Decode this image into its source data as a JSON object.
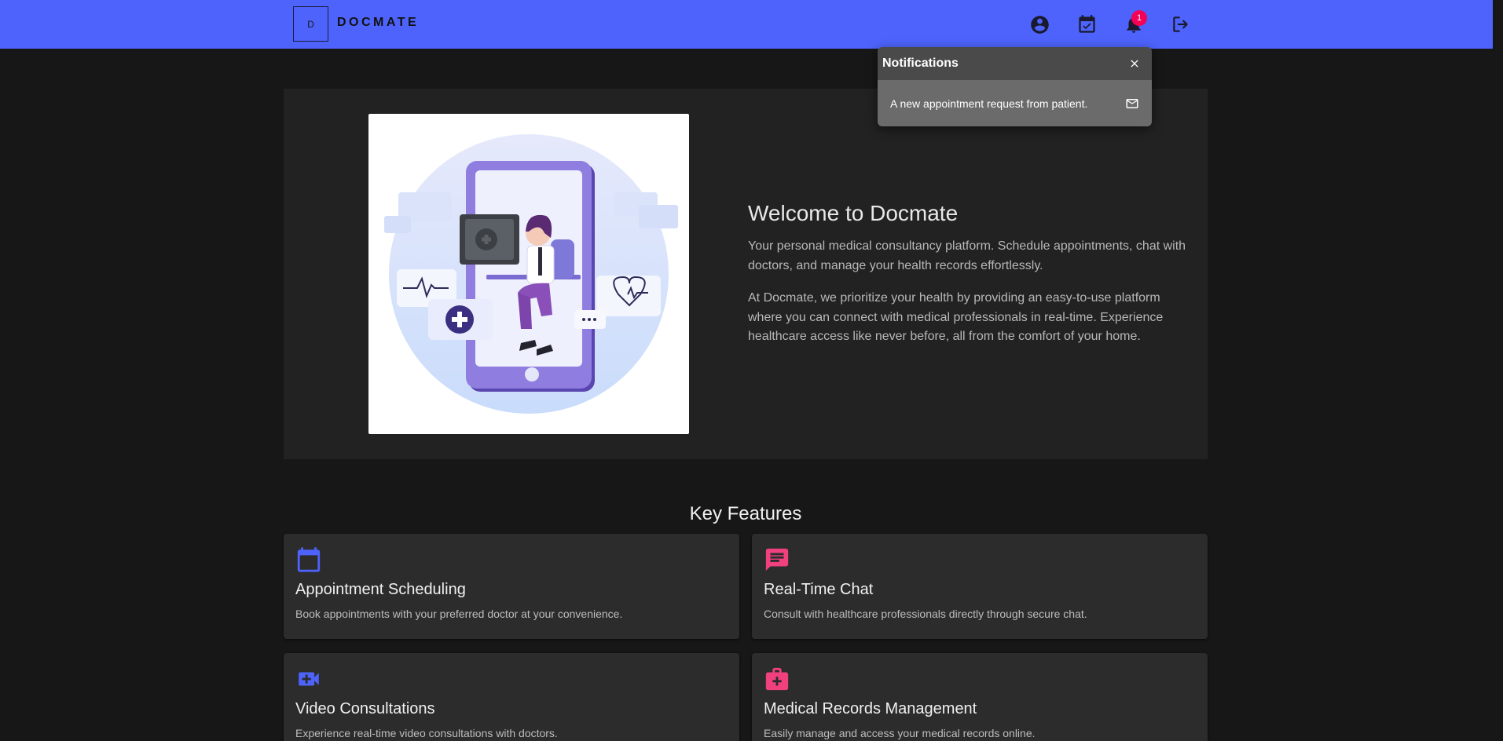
{
  "header": {
    "logo_text": "D",
    "brand": "DOCMATE",
    "notification_count": "1",
    "icons": [
      "account-circle-icon",
      "calendar-check-icon",
      "bell-icon",
      "logout-icon"
    ],
    "accent_color": "#4d63fb"
  },
  "notifications": {
    "title": "Notifications",
    "items": [
      {
        "text": "A new appointment request from patient.",
        "icon": "mail-icon"
      }
    ]
  },
  "hero": {
    "title": "Welcome to Docmate",
    "paragraph1": "Your personal medical consultancy platform. Schedule appointments, chat with doctors, and manage your health records effortlessly.",
    "paragraph2": "At Docmate, we prioritize your health by providing an easy-to-use platform where you can connect with medical professionals in real-time. Experience healthcare access like never before, all from the comfort of your home."
  },
  "features": {
    "title": "Key Features",
    "cards": [
      {
        "title": "Appointment Scheduling",
        "desc": "Book appointments with your preferred doctor at your convenience.",
        "icon": "calendar-icon",
        "color": "#4d63fb"
      },
      {
        "title": "Real-Time Chat",
        "desc": "Consult with healthcare professionals directly through secure chat.",
        "icon": "chat-icon",
        "color": "#f0417e"
      },
      {
        "title": "Video Consultations",
        "desc": "Experience real-time video consultations with doctors.",
        "icon": "video-call-icon",
        "color": "#4d63fb"
      },
      {
        "title": "Medical Records Management",
        "desc": "Easily manage and access your medical records online.",
        "icon": "medical-bag-icon",
        "color": "#f0417e"
      }
    ]
  }
}
